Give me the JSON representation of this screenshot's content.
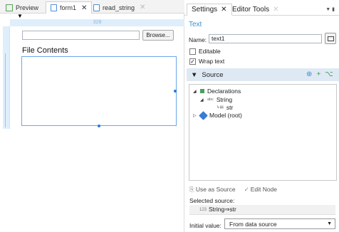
{
  "left_tabs": [
    {
      "label": "Preview"
    },
    {
      "label": "form1",
      "close": "✕"
    },
    {
      "label": "read_string",
      "close": "✕"
    }
  ],
  "ruler": {
    "width_label": "328"
  },
  "form": {
    "browse_label": "Browse...",
    "file_contents_label": "File Contents"
  },
  "right_tabs": [
    {
      "label": "Settings",
      "close": "✕"
    },
    {
      "label": "Editor Tools",
      "close": "✕"
    }
  ],
  "settings": {
    "section_title": "Text",
    "name_label": "Name:",
    "name_value": "text1",
    "editable_label": "Editable",
    "editable_checked": false,
    "wrap_label": "Wrap text",
    "wrap_checked": true
  },
  "source": {
    "title": "Source",
    "tree": {
      "declarations": "Declarations",
      "string": "String",
      "str": "str",
      "model": "Model (root)",
      "string_prefix": "abc"
    },
    "use_as_source": "Use as Source",
    "edit_node": "Edit Node",
    "selected_label": "Selected source:",
    "selected_value": "String⇒str",
    "selected_prefix": "123",
    "initial_label": "Initial value:",
    "initial_value": "From data source"
  },
  "colors": {
    "accent": "#3a8fd0",
    "source_header_bg": "#dfe9f4",
    "ruler_bg": "#dfeefb"
  }
}
